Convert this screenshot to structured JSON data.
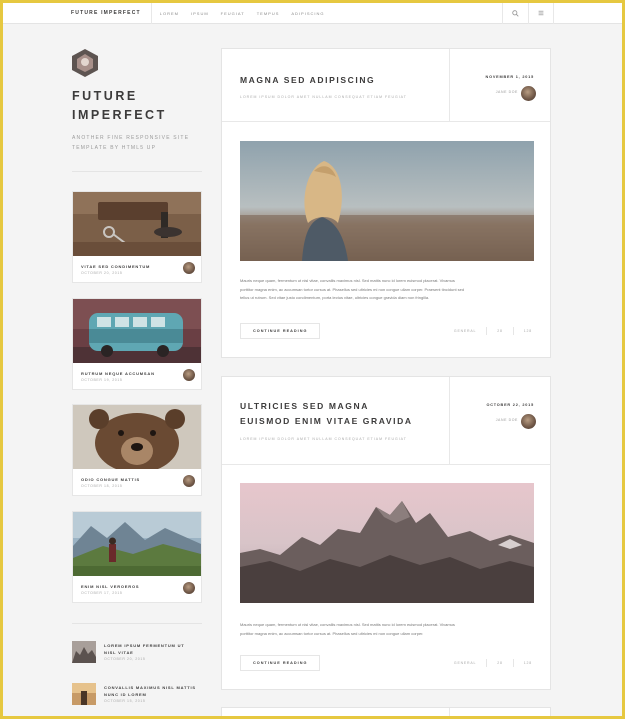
{
  "nav": {
    "brand": "FUTURE IMPERFECT",
    "links": [
      "LOREM",
      "IPSUM",
      "FEUGIAT",
      "TEMPUS",
      "ADIPISCING"
    ],
    "search_icon": "search-icon",
    "menu_icon": "menu-icon"
  },
  "sidebar": {
    "title_line1": "FUTURE",
    "title_line2": "IMPERFECT",
    "subtitle_line1": "ANOTHER FINE RESPONSIVE SITE",
    "subtitle_line2": "TEMPLATE BY HTML5 UP",
    "mini_posts": [
      {
        "title": "VITAE SED CONDIMENTUM",
        "date": "OCTOBER 20, 2015"
      },
      {
        "title": "RUTRUM NEQUE ACCUMSAN",
        "date": "OCTOBER 19, 2015"
      },
      {
        "title": "ODIO CONGUE MATTIS",
        "date": "OCTOBER 18, 2015"
      },
      {
        "title": "ENIM NISL VEROEROS",
        "date": "OCTOBER 17, 2015"
      }
    ],
    "list_posts": [
      {
        "title_line1": "LOREM IPSUM FERMENTUM UT",
        "title_line2": "NISL VITAE",
        "date": "OCTOBER 20, 2015"
      },
      {
        "title_line1": "CONVALLIS MAXIMUS NISL MATTIS",
        "title_line2": "NUNC ID LOREM",
        "date": "OCTOBER 15, 2015"
      }
    ]
  },
  "posts": [
    {
      "title_line1": "MAGNA SED ADIPISCING",
      "title_line2": "",
      "subtitle": "LOREM IPSUM DOLOR AMET NULLAM CONSEQUAT ETIAM FEUGIAT",
      "date": "NOVEMBER 1, 2015",
      "author": "JANE DOE",
      "excerpt_lines": [
        "Mauris neque quam, fermentum ut nisl vitae, convallis maximus nisl. Sed mattis nunc id lorem euismod placerat. Vivamus",
        "porttitor magna enim, ac accumsan tortor cursus at. Phasellus sed ultricies mi non congue ullam corper. Praesent tincidunt sed",
        "tellus ut rutrum. Sed vitae justo condimentum, porta lectus vitae, ultricies congue gravida diam non fringilla."
      ],
      "cta": "CONTINUE READING",
      "stat_general": "GENERAL",
      "stat_likes": "28",
      "stat_comments": "128"
    },
    {
      "title_line1": "ULTRICIES SED MAGNA",
      "title_line2": "EUISMOD ENIM VITAE GRAVIDA",
      "subtitle": "LOREM IPSUM DOLOR AMET NULLAM CONSEQUAT ETIAM FEUGIAT",
      "date": "OCTOBER 22, 2015",
      "author": "JANE DOE",
      "excerpt_lines": [
        "Mauris neque quam, fermentum ut nisl vitae, convallis maximus nisl. Sed mattis nunc id lorem euismod placerat. Vivamus",
        "porttitor magna enim, ac accumsan tortor cursus at. Phasellus sed ultricies mi non congue ullam corper."
      ],
      "cta": "CONTINUE READING",
      "stat_general": "GENERAL",
      "stat_likes": "28",
      "stat_comments": "128"
    }
  ],
  "colors": {
    "frame": "#e6c840",
    "background": "#f4f4f4",
    "text": "#3c3b3b",
    "muted": "#aaaaaa"
  }
}
